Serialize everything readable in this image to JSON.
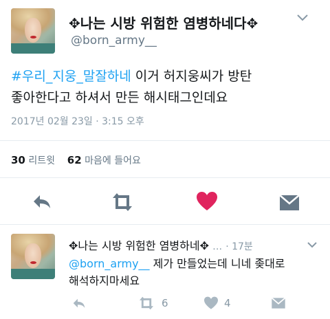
{
  "main_tweet": {
    "display_name": "✥나는 시방 위험한 염병하네다✥",
    "handle": "@born_army__",
    "hashtag": "#우리_지웅_말잘하네",
    "text_line1_rest": " 이거 허지웅씨가 방탄",
    "text_line2": "좋아한다고 하셔서 만든 해시태그인데요",
    "timestamp": "2017년 02월 23일 · 3:15 오후",
    "retweets_count": "30",
    "retweets_label": "리트윗",
    "likes_count": "62",
    "likes_label": "마음에 들어요"
  },
  "reply_tweet": {
    "display_name": "✥나는 시방 위험한 염병하네✥",
    "ellipsis": "…",
    "time_ago": "· 17분",
    "mention": "@born_army__",
    "text_line1_rest": " 제가 만들었는데 니네 좆대로",
    "text_line2": "해석하지마세요",
    "retweet_count": "6",
    "like_count": "4"
  },
  "colors": {
    "accent_blue": "#1da1f2",
    "like_red": "#e0245e",
    "icon_gray": "#657786"
  },
  "icons": [
    "chevron-down-icon",
    "reply-icon",
    "retweet-icon",
    "heart-icon",
    "direct-message-icon"
  ]
}
